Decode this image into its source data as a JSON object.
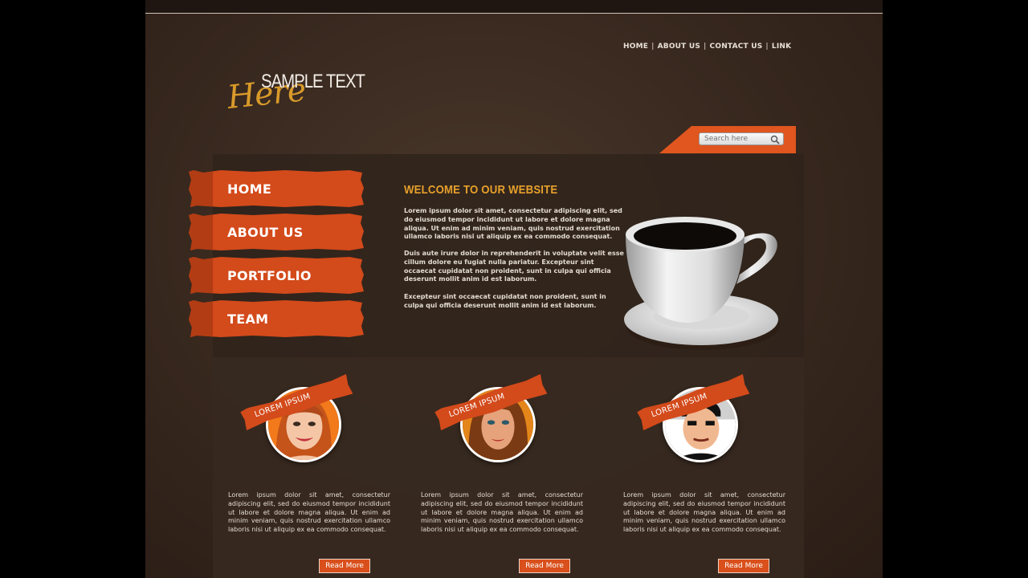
{
  "nav": {
    "items": [
      "HOME",
      "ABOUT US",
      "CONTACT US",
      "LINK"
    ],
    "separator": "|"
  },
  "logo": {
    "main": "SAMPLE TEXT",
    "script": "Here"
  },
  "search": {
    "placeholder": "Search here",
    "icon": "magnifier-icon"
  },
  "menu": {
    "items": [
      "HOME",
      "ABOUT US",
      "PORTFOLIO",
      "TEAM"
    ]
  },
  "welcome": {
    "title": "WELCOME TO OUR WEBSITE",
    "paragraphs": [
      "Lorem ipsum dolor sit amet, consectetur adipiscing elit, sed do eiusmod tempor incididunt ut labore et dolore magna aliqua. Ut enim ad minim veniam, quis nostrud exercitation ullamco laboris nisi ut aliquip ex ea commodo consequat.",
      "Duis aute irure dolor in reprehenderit in voluptate velit esse cillum dolore eu fugiat nulla pariatur. Excepteur sint occaecat cupidatat non proident, sunt in culpa qui officia deserunt mollit anim id est laborum.",
      "Excepteur sint occaecat cupidatat non proident, sunt in culpa qui officia deserunt mollit anim id est laborum."
    ]
  },
  "team": [
    {
      "ribbon": "LOREM IPSUM",
      "description": "Lorem ipsum dolor sit amet, consectetur adipiscing elit, sed do eiusmod tempor incididunt ut labore et dolore magna aliqua. Ut enim ad minim veniam, quis nostrud exercitation ullamco laboris nisi ut aliquip ex ea commodo consequat.",
      "button": "Read More"
    },
    {
      "ribbon": "LOREM IPSUM",
      "description": "Lorem ipsum dolor sit amet, consectetur adipiscing elit, sed do eiusmod tempor incididunt ut labore et dolore magna aliqua. Ut enim ad minim veniam, quis nostrud exercitation ullamco laboris nisi ut aliquip ex ea commodo consequat.",
      "button": "Read More"
    },
    {
      "ribbon": "LOREM IPSUM",
      "description": "Lorem ipsum dolor sit amet, consectetur adipiscing elit, sed do eiusmod tempor incididunt ut labore et dolore magna aliqua. Ut enim ad minim veniam, quis nostrud exercitation ullamco laboris nisi ut aliquip ex ea commodo consequat.",
      "button": "Read More"
    }
  ],
  "colors": {
    "accent": "#d34a1b",
    "title": "#e7a02b",
    "background": "#3a2a20",
    "text": "#e4dcd2"
  }
}
